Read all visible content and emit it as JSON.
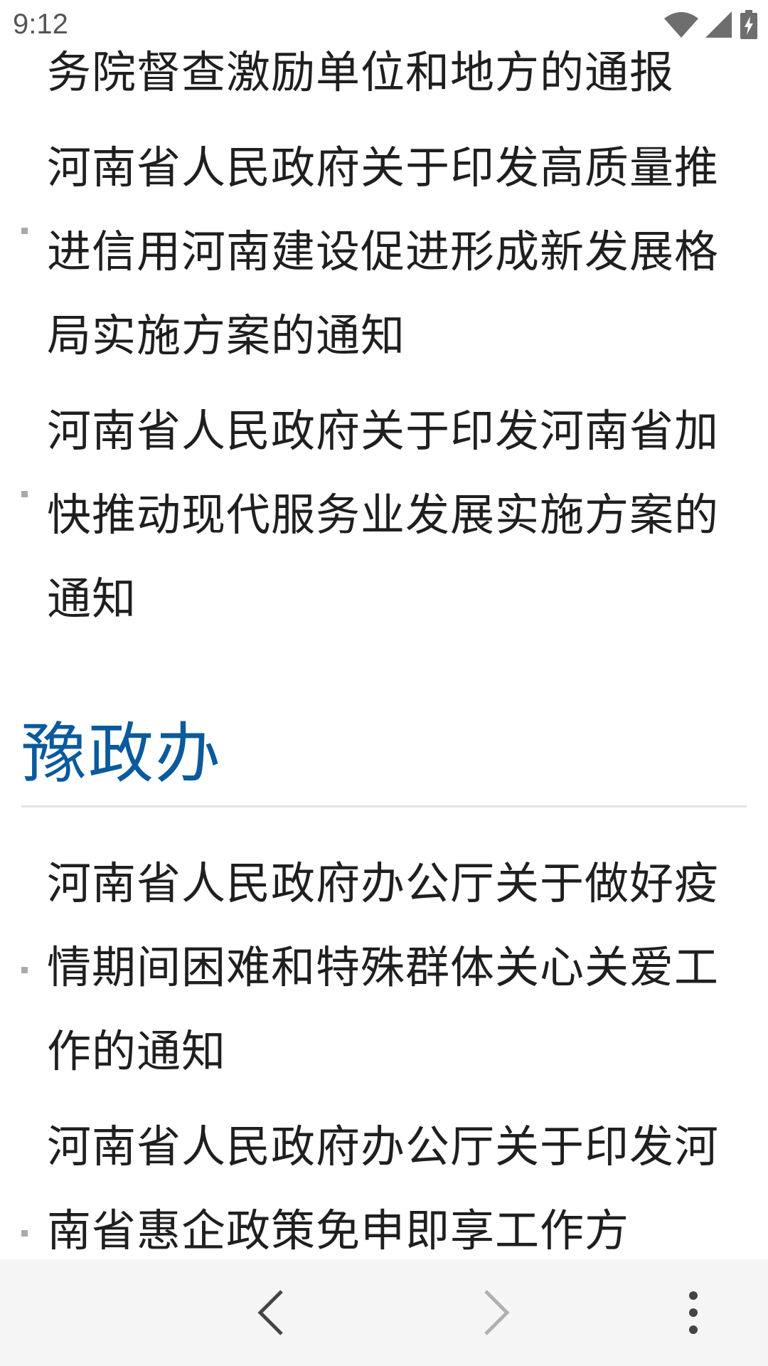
{
  "status_bar": {
    "time": "9:12",
    "icons": [
      "wifi-icon",
      "signal-icon",
      "battery-icon"
    ]
  },
  "top_list": {
    "items": [
      {
        "text": "务院督查激励单位和地方的通报",
        "bullet": false
      },
      {
        "text": "河南省人民政府关于印发高质量推进信用河南建设促进形成新发展格局实施方案的通知",
        "bullet": true
      },
      {
        "text": "河南省人民政府关于印发河南省加快推动现代服务业发展实施方案的通知",
        "bullet": true
      }
    ]
  },
  "section": {
    "title": "豫政办"
  },
  "section_list": {
    "items": [
      {
        "text": "河南省人民政府办公厅关于做好疫情期间困难和特殊群体关心关爱工作的通知",
        "bullet": true
      },
      {
        "text": "河南省人民政府办公厅关于印发河南省惠企政策免申即享工作方",
        "bullet": true
      }
    ]
  },
  "toolbar": {
    "icons": [
      "back-icon",
      "forward-icon",
      "more-vert-icon"
    ],
    "colors": {
      "background": "#f5f5f5",
      "enabled": "#444444",
      "disabled": "#b0b0b0"
    }
  },
  "colors": {
    "heading": "#0a5a9c",
    "text": "#1f1f1f",
    "bullet": "#aaaaaa",
    "divider": "#e4e4e4"
  }
}
